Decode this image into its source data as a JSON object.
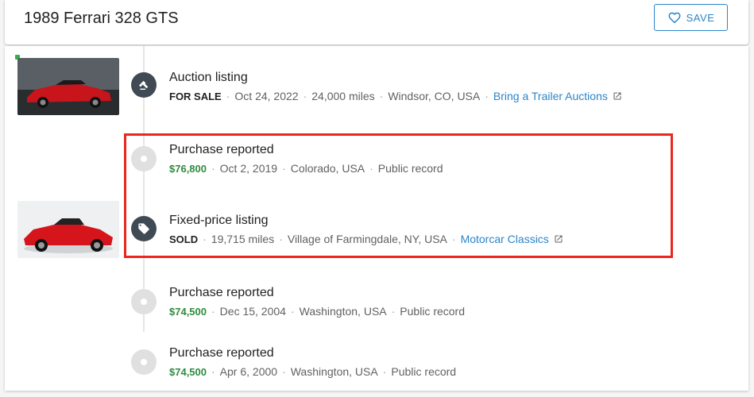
{
  "header": {
    "title": "1989 Ferrari 328 GTS",
    "save_label": "SAVE"
  },
  "events": [
    {
      "title": "Auction listing",
      "status": "FOR SALE",
      "date": "Oct 24, 2022",
      "mileage": "24,000 miles",
      "location": "Windsor, CO, USA",
      "source": "Bring a Trailer Auctions",
      "icon": "gavel-icon"
    },
    {
      "title": "Purchase reported",
      "price": "$76,800",
      "date": "Oct 2, 2019",
      "location": "Colorado, USA",
      "source": "Public record",
      "icon": "dot-icon"
    },
    {
      "title": "Fixed-price listing",
      "status": "SOLD",
      "mileage": "19,715 miles",
      "location": "Village of Farmingdale, NY, USA",
      "source": "Motorcar Classics",
      "icon": "tag-icon"
    },
    {
      "title": "Purchase reported",
      "price": "$74,500",
      "date": "Dec 15, 2004",
      "location": "Washington, USA",
      "source": "Public record",
      "icon": "dot-icon"
    },
    {
      "title": "Purchase reported",
      "price": "$74,500",
      "date": "Apr 6, 2000",
      "location": "Washington, USA",
      "source": "Public record",
      "icon": "dot-icon"
    }
  ],
  "colors": {
    "accent": "#2b85c9",
    "price": "#2e8b3e",
    "highlight": "#e8281f",
    "new_indicator": "#2fb24c"
  },
  "separator": "·"
}
